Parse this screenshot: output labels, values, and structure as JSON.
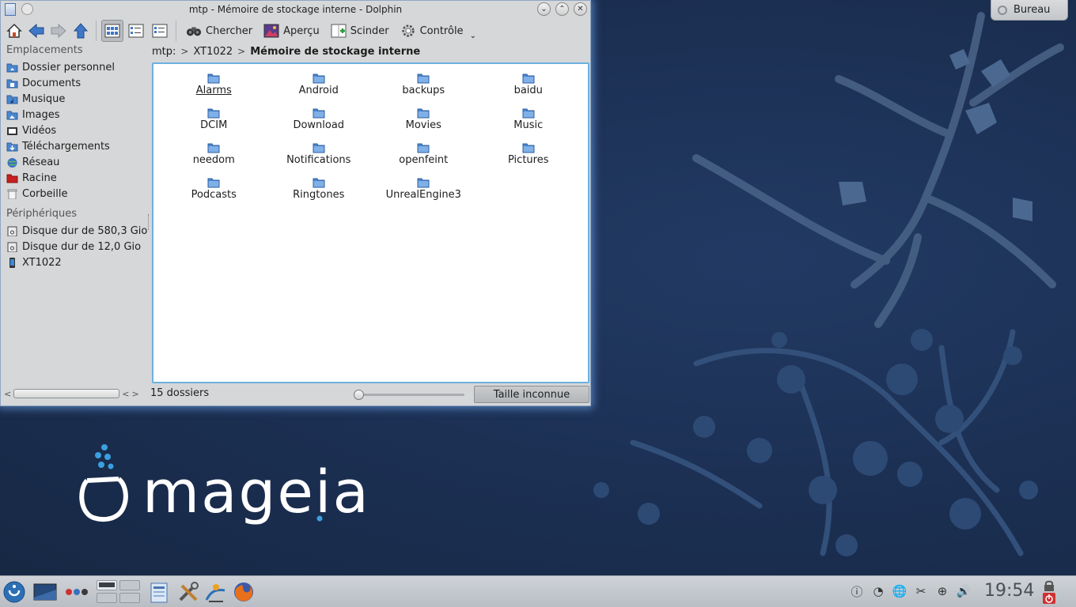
{
  "desktop": {
    "brand": "mageia",
    "bureau_label": "Bureau"
  },
  "window": {
    "title": "mtp - Mémoire de stockage interne - Dolphin",
    "toolbar": {
      "search_label": "Chercher",
      "preview_label": "Aperçu",
      "split_label": "Scinder",
      "control_label": "Contrôle"
    },
    "sidebar": {
      "places_header": "Emplacements",
      "places": [
        {
          "label": "Dossier personnel",
          "icon": "home-folder-icon"
        },
        {
          "label": "Documents",
          "icon": "documents-folder-icon"
        },
        {
          "label": "Musique",
          "icon": "music-folder-icon"
        },
        {
          "label": "Images",
          "icon": "pictures-folder-icon"
        },
        {
          "label": "Vidéos",
          "icon": "videos-folder-icon"
        },
        {
          "label": "Téléchargements",
          "icon": "downloads-folder-icon"
        },
        {
          "label": "Réseau",
          "icon": "network-icon"
        },
        {
          "label": "Racine",
          "icon": "root-folder-icon"
        },
        {
          "label": "Corbeille",
          "icon": "trash-icon"
        }
      ],
      "devices_header": "Périphériques",
      "devices": [
        {
          "label": "Disque dur de 580,3 Gio",
          "icon": "hard-disk-icon"
        },
        {
          "label": "Disque dur de 12,0 Gio",
          "icon": "hard-disk-icon"
        },
        {
          "label": "XT1022",
          "icon": "phone-icon"
        }
      ]
    },
    "breadcrumb": {
      "root": "mtp:",
      "device": "XT1022",
      "current": "Mémoire de stockage interne"
    },
    "folders": [
      "Alarms",
      "Android",
      "backups",
      "baidu",
      "DCIM",
      "Download",
      "Movies",
      "Music",
      "needom",
      "Notifications",
      "openfeint",
      "Pictures",
      "Podcasts",
      "Ringtones",
      "UnrealEngine3"
    ],
    "status": {
      "count_text": "15 dossiers",
      "space_text": "Taille inconnue"
    }
  },
  "taskbar": {
    "clock": "19:54"
  },
  "colors": {
    "desktop_bg": "#1b2f52",
    "selection_border": "#6cb1e0",
    "folder_blue": "#4a86d0"
  }
}
